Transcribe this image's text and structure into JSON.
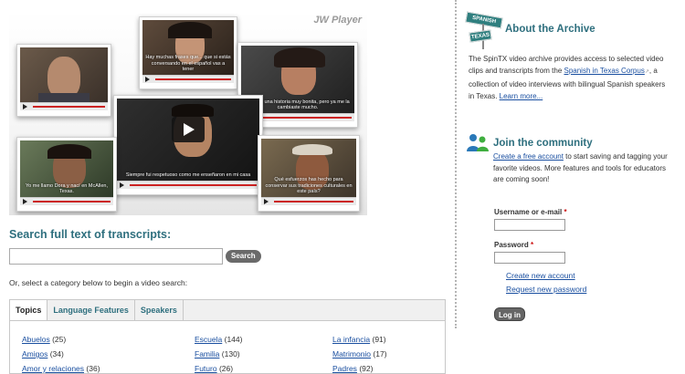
{
  "player": {
    "label": "JW Player",
    "videos": [
      {
        "id": "v1",
        "subtitle": ""
      },
      {
        "id": "v2",
        "subtitle": "Hay muchas frases que... que si estás conversando en el español vas a tener"
      },
      {
        "id": "v3",
        "subtitle": "Ese fue una historia muy bonita, pero ya me la cambiaste mucho."
      },
      {
        "id": "v4",
        "subtitle": "Siempre fui respetuoso como me enseñaron en mi casa"
      },
      {
        "id": "v5",
        "subtitle": "Yo me llamo Dora y nací en McAllen, Texas."
      },
      {
        "id": "v6",
        "subtitle": "Qué esfuerzos has hecho para conservar sus tradiciones culturales en este país?"
      }
    ]
  },
  "search": {
    "title": "Search full text of transcripts:",
    "placeholder": "",
    "button_label": "Search",
    "category_help": "Or, select a category below to begin a video search:"
  },
  "tabs": [
    {
      "label": "Topics",
      "active": true
    },
    {
      "label": "Language Features",
      "active": false
    },
    {
      "label": "Speakers",
      "active": false
    }
  ],
  "categories": {
    "col1": [
      {
        "name": "Abuelos",
        "count": "(25)"
      },
      {
        "name": "Amigos",
        "count": "(34)"
      },
      {
        "name": "Amor y relaciones",
        "count": "(36)"
      }
    ],
    "col2": [
      {
        "name": "Escuela",
        "count": "(144)"
      },
      {
        "name": "Familia",
        "count": "(130)"
      },
      {
        "name": "Futuro",
        "count": "(26)"
      }
    ],
    "col3": [
      {
        "name": "La infancia",
        "count": "(91)"
      },
      {
        "name": "Matrimonio",
        "count": "(17)"
      },
      {
        "name": "Padres",
        "count": "(92)"
      }
    ]
  },
  "about": {
    "logo_top": "SPANISH",
    "logo_bottom": "TEXAS",
    "title": "About the Archive",
    "text_before_link": "The SpinTX video archive provides access to selected video clips and transcripts from the ",
    "link": "Spanish in Texas Corpus",
    "text_after_link": ", a collection of video interviews with bilingual Spanish speakers in Texas. ",
    "learn_more": "Learn more..."
  },
  "community": {
    "title": "Join the community",
    "link": "Create a free account",
    "text": " to start saving and tagging your favorite videos. More features and tools for educators are coming soon!"
  },
  "login": {
    "username_label": "Username or e-mail",
    "password_label": "Password",
    "required_mark": "*",
    "create_account": "Create new account",
    "request_password": "Request new password",
    "login_button": "Log in"
  },
  "colors": {
    "heading": "#2e6f7e",
    "link": "#1a4fa0",
    "button": "#6a6a6a",
    "required": "#cc1111"
  }
}
